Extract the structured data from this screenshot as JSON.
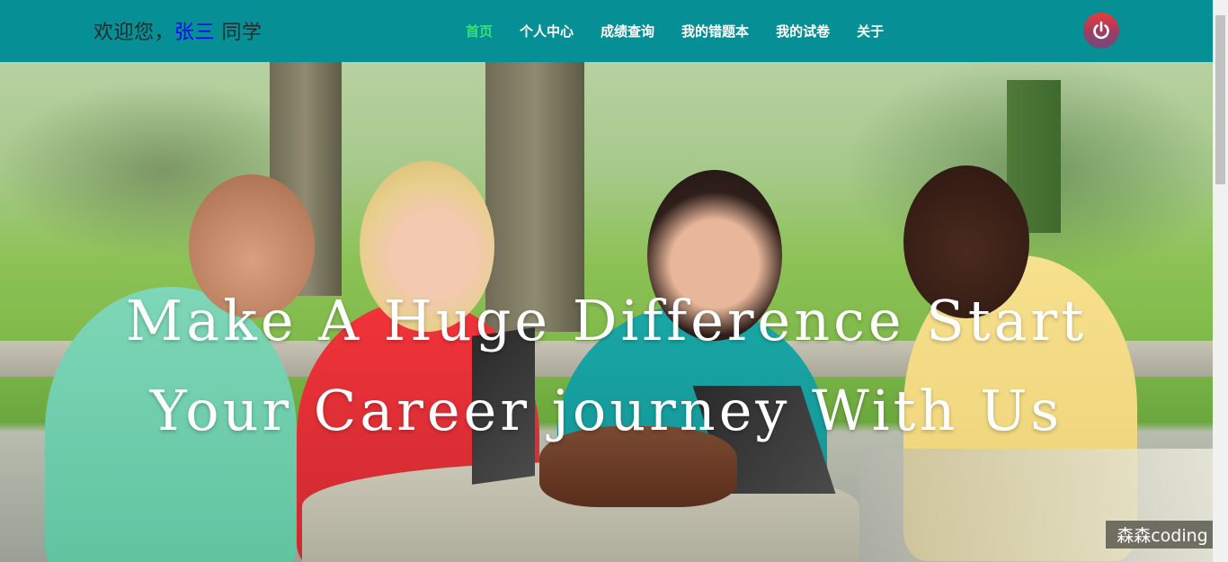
{
  "header": {
    "welcome_prefix": "欢迎您，",
    "username": "张三",
    "welcome_suffix": " 同学",
    "nav": [
      {
        "label": "首页",
        "active": true
      },
      {
        "label": "个人中心",
        "active": false
      },
      {
        "label": "成绩查询",
        "active": false
      },
      {
        "label": "我的错题本",
        "active": false
      },
      {
        "label": "我的试卷",
        "active": false
      },
      {
        "label": "关于",
        "active": false
      }
    ],
    "power_icon": "power-icon"
  },
  "hero": {
    "line1": "Make A Huge Difference Start",
    "line2": "Your Career journey With Us"
  },
  "watermark": "森森coding",
  "colors": {
    "header_bg": "#068f95",
    "nav_active": "#39e07a",
    "username": "#0000ff"
  }
}
